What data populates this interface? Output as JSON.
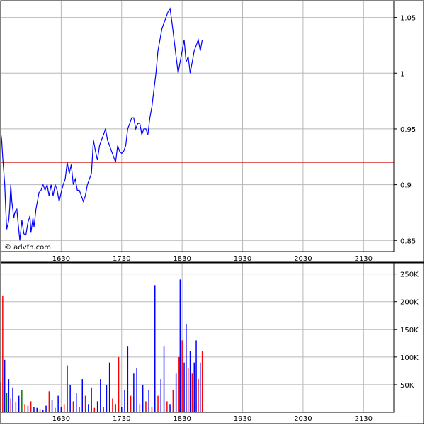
{
  "watermark": "© advfn.com",
  "chart_data": [
    {
      "type": "line",
      "panel": "price",
      "x_unit": "time of day (HHMM)",
      "xlim": [
        1530,
        2200
      ],
      "ylim": [
        0.84,
        1.065
      ],
      "grid": true,
      "xticks": [
        1630,
        1730,
        1830,
        1930,
        2030,
        2130
      ],
      "yticks": [
        0.85,
        0.9,
        0.95,
        1,
        1.05
      ],
      "xtick_labels": [
        "1630",
        "1730",
        "1830",
        "1930",
        "2030",
        "2130"
      ],
      "ytick_labels": [
        "0.85",
        "0.9",
        "0.95",
        "1",
        "1.05"
      ],
      "reference_line": 0.92,
      "series": [
        {
          "color": "#0000ff",
          "x": [
            1530,
            1531,
            1532,
            1534,
            1535,
            1536,
            1538,
            1539,
            1540,
            1541,
            1543,
            1544,
            1546,
            1547,
            1549,
            1551,
            1553,
            1555,
            1557,
            1559,
            1600,
            1602,
            1603,
            1605,
            1607,
            1608,
            1610,
            1612,
            1614,
            1616,
            1618,
            1620,
            1622,
            1624,
            1626,
            1628,
            1630,
            1632,
            1634,
            1636,
            1638,
            1640,
            1642,
            1644,
            1646,
            1648,
            1650,
            1652,
            1654,
            1656,
            1658,
            1700,
            1702,
            1704,
            1706,
            1708,
            1710,
            1712,
            1714,
            1716,
            1718,
            1720,
            1722,
            1724,
            1726,
            1728,
            1730,
            1732,
            1734,
            1736,
            1738,
            1740,
            1742,
            1744,
            1746,
            1748,
            1750,
            1752,
            1754,
            1756,
            1758,
            1800,
            1802,
            1804,
            1806,
            1808,
            1810,
            1812,
            1814,
            1816,
            1818,
            1820,
            1822,
            1824,
            1826,
            1828,
            1830,
            1832,
            1834,
            1836,
            1838,
            1840,
            1842,
            1844,
            1846,
            1848,
            1850
          ],
          "y": [
            0.947,
            0.94,
            0.925,
            0.9,
            0.878,
            0.86,
            0.868,
            0.88,
            0.9,
            0.885,
            0.87,
            0.875,
            0.878,
            0.868,
            0.85,
            0.868,
            0.856,
            0.855,
            0.866,
            0.872,
            0.857,
            0.87,
            0.862,
            0.878,
            0.888,
            0.893,
            0.895,
            0.9,
            0.895,
            0.9,
            0.89,
            0.9,
            0.89,
            0.9,
            0.895,
            0.885,
            0.893,
            0.9,
            0.905,
            0.92,
            0.91,
            0.918,
            0.9,
            0.905,
            0.895,
            0.895,
            0.89,
            0.885,
            0.89,
            0.9,
            0.905,
            0.91,
            0.94,
            0.93,
            0.922,
            0.935,
            0.94,
            0.945,
            0.95,
            0.94,
            0.935,
            0.93,
            0.925,
            0.92,
            0.935,
            0.93,
            0.928,
            0.93,
            0.935,
            0.95,
            0.955,
            0.96,
            0.96,
            0.95,
            0.955,
            0.955,
            0.945,
            0.95,
            0.95,
            0.945,
            0.96,
            0.97,
            0.985,
            1.0,
            1.02,
            1.03,
            1.04,
            1.045,
            1.05,
            1.055,
            1.058,
            1.045,
            1.03,
            1.015,
            1.0,
            1.01,
            1.02,
            1.03,
            1.01,
            1.015,
            1.0,
            1.01,
            1.02,
            1.025,
            1.03,
            1.02,
            1.03
          ],
          "x_note": "minutes mapped linearly between hour ticks",
          "values_note": "estimated from gridlines"
        }
      ]
    },
    {
      "type": "bar",
      "panel": "volume",
      "xlim": [
        1530,
        2200
      ],
      "ylim": [
        0,
        270000
      ],
      "grid": true,
      "xticks": [
        1630,
        1730,
        1830,
        1930,
        2030,
        2130
      ],
      "yticks": [
        50000,
        100000,
        150000,
        200000,
        250000
      ],
      "xtick_labels": [
        "1630",
        "1730",
        "1830",
        "1930",
        "2030",
        "2130"
      ],
      "ytick_labels": [
        "50K",
        "100K",
        "150K",
        "200K",
        "250K"
      ],
      "bars": {
        "x": [
          1530,
          1532,
          1534,
          1536,
          1538,
          1540,
          1542,
          1545,
          1548,
          1551,
          1554,
          1557,
          1600,
          1603,
          1606,
          1609,
          1612,
          1615,
          1618,
          1621,
          1624,
          1627,
          1630,
          1633,
          1636,
          1639,
          1642,
          1645,
          1648,
          1651,
          1654,
          1657,
          1700,
          1703,
          1706,
          1709,
          1712,
          1715,
          1718,
          1721,
          1724,
          1727,
          1730,
          1733,
          1736,
          1739,
          1742,
          1745,
          1748,
          1751,
          1754,
          1757,
          1800,
          1803,
          1806,
          1809,
          1812,
          1815,
          1818,
          1821,
          1824,
          1827,
          1828,
          1830,
          1832,
          1834,
          1836,
          1838,
          1840,
          1842,
          1844,
          1846,
          1848,
          1850
        ],
        "values": [
          55000,
          210000,
          95000,
          35000,
          60000,
          25000,
          45000,
          18000,
          30000,
          40000,
          15000,
          12000,
          20000,
          10000,
          8000,
          6000,
          5000,
          12000,
          38000,
          22000,
          8000,
          30000,
          10000,
          15000,
          85000,
          50000,
          20000,
          35000,
          10000,
          60000,
          30000,
          15000,
          45000,
          8000,
          20000,
          60000,
          10000,
          50000,
          90000,
          25000,
          15000,
          100000,
          10000,
          40000,
          120000,
          30000,
          70000,
          80000,
          15000,
          50000,
          20000,
          40000,
          10000,
          230000,
          30000,
          60000,
          120000,
          20000,
          15000,
          40000,
          70000,
          100000,
          240000,
          130000,
          90000,
          160000,
          80000,
          110000,
          70000,
          90000,
          130000,
          60000,
          90000,
          110000
        ],
        "colors": [
          "#ff0000",
          "#ff0000",
          "#0000ff",
          "#008000",
          "#0000ff",
          "#ff0000",
          "#0000ff",
          "#ff0000",
          "#0000ff",
          "#008000",
          "#ff0000",
          "#0000ff",
          "#ff0000",
          "#0000ff",
          "#0000ff",
          "#ff0000",
          "#0000ff",
          "#0000ff",
          "#ff0000",
          "#0000ff",
          "#ff0000",
          "#0000ff",
          "#0000ff",
          "#ff0000",
          "#0000ff",
          "#0000ff",
          "#ff0000",
          "#0000ff",
          "#ff0000",
          "#0000ff",
          "#ff0000",
          "#0000ff",
          "#0000ff",
          "#ff0000",
          "#0000ff",
          "#0000ff",
          "#ff0000",
          "#0000ff",
          "#0000ff",
          "#ff0000",
          "#ff0000",
          "#ff0000",
          "#0000ff",
          "#0000ff",
          "#0000ff",
          "#ff0000",
          "#0000ff",
          "#0000ff",
          "#ff0000",
          "#0000ff",
          "#ff0000",
          "#0000ff",
          "#ff0000",
          "#0000ff",
          "#ff0000",
          "#0000ff",
          "#0000ff",
          "#ff0000",
          "#0000ff",
          "#ff0000",
          "#0000ff",
          "#ff0000",
          "#0000ff",
          "#ff0000",
          "#0000ff",
          "#0000ff",
          "#ff0000",
          "#0000ff",
          "#ff0000",
          "#0000ff",
          "#0000ff",
          "#ff0000",
          "#0000ff",
          "#ff0000"
        ]
      }
    }
  ],
  "colors": {
    "reference_line": "#cc0000",
    "grid": "#b8b8b8",
    "frame": "#000000",
    "price_line": "#0000ff"
  }
}
